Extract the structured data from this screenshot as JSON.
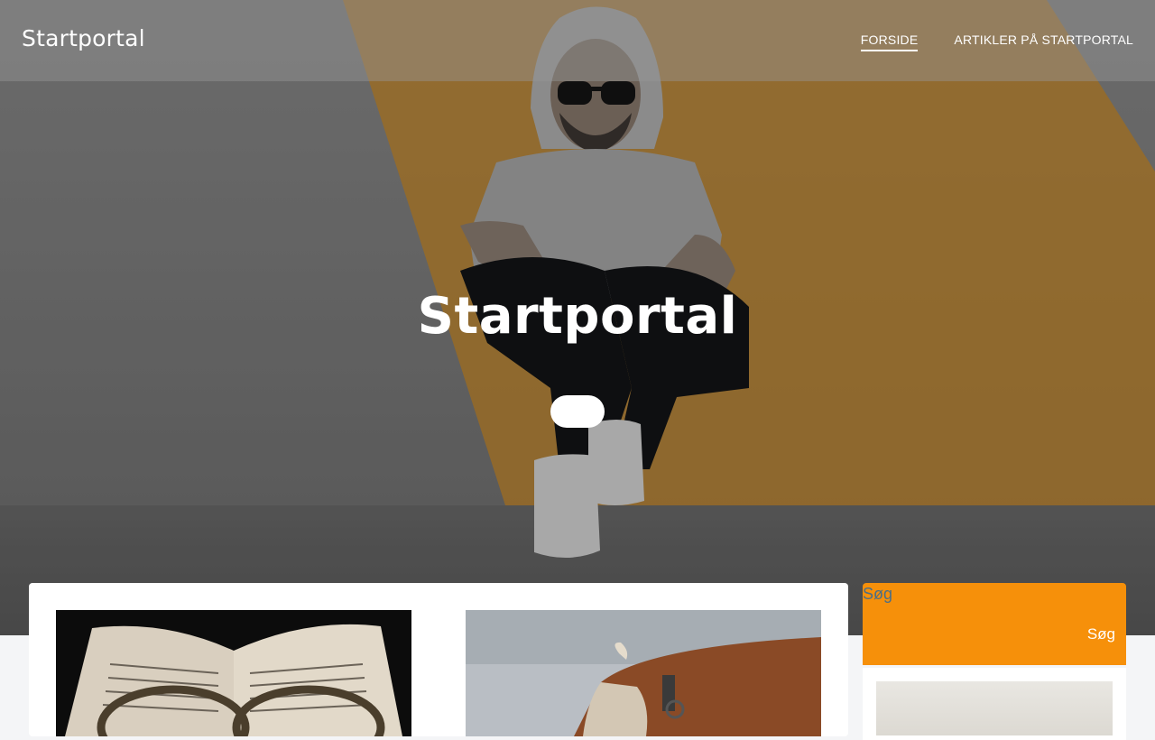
{
  "header": {
    "brand": "Startportal",
    "nav": [
      {
        "label": "FORSIDE",
        "active": true
      },
      {
        "label": "ARTIKLER PÅ STARTPORTAL",
        "active": false
      }
    ]
  },
  "hero": {
    "title": "Startportal"
  },
  "sidebar": {
    "search_label": "Søg",
    "search_button": "Søg"
  },
  "colors": {
    "accent": "#f6900a",
    "label_blue": "#4b6e86"
  }
}
